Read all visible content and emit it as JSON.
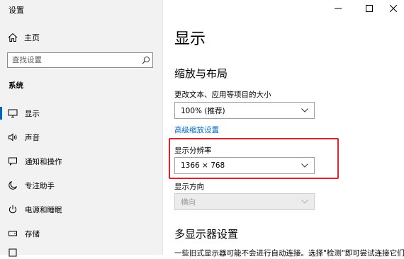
{
  "window": {
    "title": "设置"
  },
  "sidebar": {
    "home_label": "主页",
    "search_placeholder": "查找设置",
    "section_label": "系统",
    "items": [
      {
        "label": "显示",
        "icon": "monitor-icon",
        "active": true
      },
      {
        "label": "声音",
        "icon": "speaker-icon"
      },
      {
        "label": "通知和操作",
        "icon": "notification-icon"
      },
      {
        "label": "专注助手",
        "icon": "moon-icon"
      },
      {
        "label": "电源和睡眠",
        "icon": "power-icon"
      },
      {
        "label": "存储",
        "icon": "storage-icon"
      }
    ]
  },
  "main": {
    "title": "显示",
    "scale_section": {
      "title": "缩放与布局",
      "scale_label": "更改文本、应用等项目的大小",
      "scale_value": "100% (推荐)",
      "advanced_link": "高级缩放设置",
      "resolution_label": "显示分辨率",
      "resolution_value": "1366 × 768",
      "orientation_label": "显示方向",
      "orientation_value": "横向"
    },
    "multi_section": {
      "title": "多显示器设置",
      "partial_text": "一些旧式显示器可能不会进行自动连接。选择\"检测\"即可尝试连接它们。"
    }
  },
  "colors": {
    "accent": "#0067c0",
    "highlight": "#e0202a"
  }
}
